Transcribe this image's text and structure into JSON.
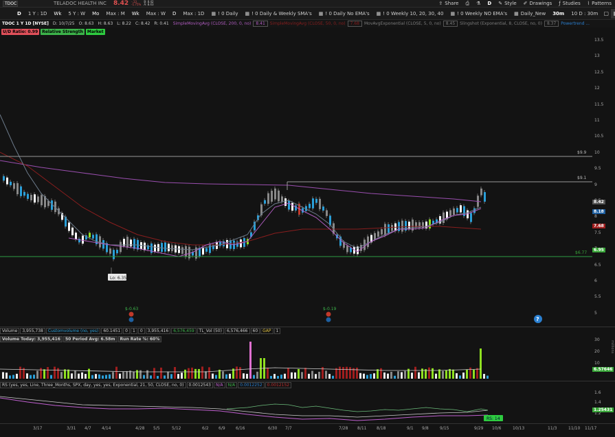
{
  "topbar": {
    "symbol": "TDOC",
    "company": "TELADOC HEALTH INC",
    "last": "8.42",
    "change": "-.13",
    "change_pct": "-1.75%",
    "bid": "B: 8.42",
    "ask": "A: 8.43",
    "share": "Share",
    "d_label": "D",
    "style": "Style",
    "drawings": "Drawings",
    "studies": "Studies",
    "patterns": "Patterns"
  },
  "toolbar": {
    "items": [
      "D",
      "1 Y : 1D",
      "Wk",
      "5 Y : W",
      "Mo",
      "Max : M",
      "Wk",
      "Max : W",
      "D",
      "Max : 1D",
      "! 0 Daily",
      "! 0 Daily & Weekly SMA's",
      "! 0 Daily No EMA's",
      "! 0 Weekly 10, 20, 30, 40",
      "! 0 Weekly NO EMA's",
      "Daily_New",
      "30m",
      "10 D : 30m"
    ]
  },
  "studybar": {
    "title": "TDOC 1 Y 1D [NYSE]",
    "ohlc": [
      "D: 10/7/25",
      "O: 8.63",
      "H: 8.63",
      "L: 8.22",
      "C: 8.42",
      "R: 0.41"
    ],
    "studies": [
      {
        "label": "SimpleMovingAvg (CLOSE, 200, 0, no)",
        "value": "8.41",
        "color": "#b05cc0"
      },
      {
        "label": "SimpleMovingAvg (CLOSE, 50, 0, no)",
        "value": "7.68",
        "color": "#8a1e1e"
      },
      {
        "label": "MovAvgExponential (CLOSE, 5, 0, no)",
        "value": "8.45",
        "color": "#7d7d7d"
      },
      {
        "label": "Slingshot (Exponential, 8, CLOSE, no, 0)",
        "value": "8.37",
        "color": "#7d7d7d"
      },
      {
        "label": "Powertrend ...",
        "value": "",
        "color": "#2a7fd0"
      }
    ]
  },
  "labels": {
    "ud_ratio": "U/D Ratio: 0.99",
    "relative_strength": "Relative Strength",
    "market": "Market",
    "colors": {
      "ud": "#e0505a",
      "rs": "#3cb34a",
      "market": "#2ecc40"
    }
  },
  "price_axis": {
    "ticks": [
      "13.5",
      "13",
      "12.5",
      "12",
      "11.5",
      "11",
      "10.5",
      "10",
      "9.5",
      "9",
      "8.5",
      "8",
      "7.5",
      "7",
      "6.5",
      "6",
      "5.5",
      "5"
    ],
    "tags": [
      {
        "text": "8.42",
        "color": "#555555"
      },
      {
        "text": "8.18",
        "color": "#1e5fa0"
      },
      {
        "text": "7.68",
        "color": "#a01e1e"
      },
      {
        "text": "6.95",
        "color": "#3aa83a"
      }
    ]
  },
  "chart": {
    "levels": [
      "$9.9",
      "$9.1",
      "$6.77"
    ],
    "low_label": "Lo: 6.35",
    "events": [
      "$-0.63",
      "$-0.19"
    ],
    "earnings_marker": "?"
  },
  "volume": {
    "header": [
      "Volume",
      "3,955,738",
      "Customvolume (no, yes)",
      "60.1451",
      "0",
      "1",
      "0",
      "3,955,416",
      "6,576,459",
      "TL_Vol (50)",
      "6,576,466",
      "60",
      "GAP",
      "1"
    ],
    "today": "Volume Today: 3,955,416",
    "avg": "50 Period Avg: 6.58m",
    "run_rate": "Run Rate %: 60%",
    "axis": [
      "30",
      "20",
      "10"
    ],
    "tag": "6.57646",
    "unit": "millions"
  },
  "rs": {
    "header": "RS (yes, yes, Line, Three_Months, SPX, day, yes, yes, Exponential, 21, 50, CLOSE, no, 0)",
    "v1": "0.0012543",
    "na1": "N/A",
    "na2": "N/A",
    "v2": "0.0012252",
    "v3": "0.0012152",
    "axis": [
      "1.6",
      "1.4",
      "1.2"
    ],
    "tag": "1.25431",
    "rs_label": "RS: 14"
  },
  "xaxis": {
    "ticks": [
      "3/17",
      "3/31",
      "4/7",
      "4/14",
      "4/28",
      "5/5",
      "5/12",
      "6/2",
      "6/9",
      "6/16",
      "6/30",
      "7/7",
      "7/28",
      "8/11",
      "8/18",
      "9/1",
      "9/8",
      "9/15",
      "9/29",
      "10/6",
      "10/13",
      "11/3",
      "11/10",
      "11/17"
    ]
  }
}
